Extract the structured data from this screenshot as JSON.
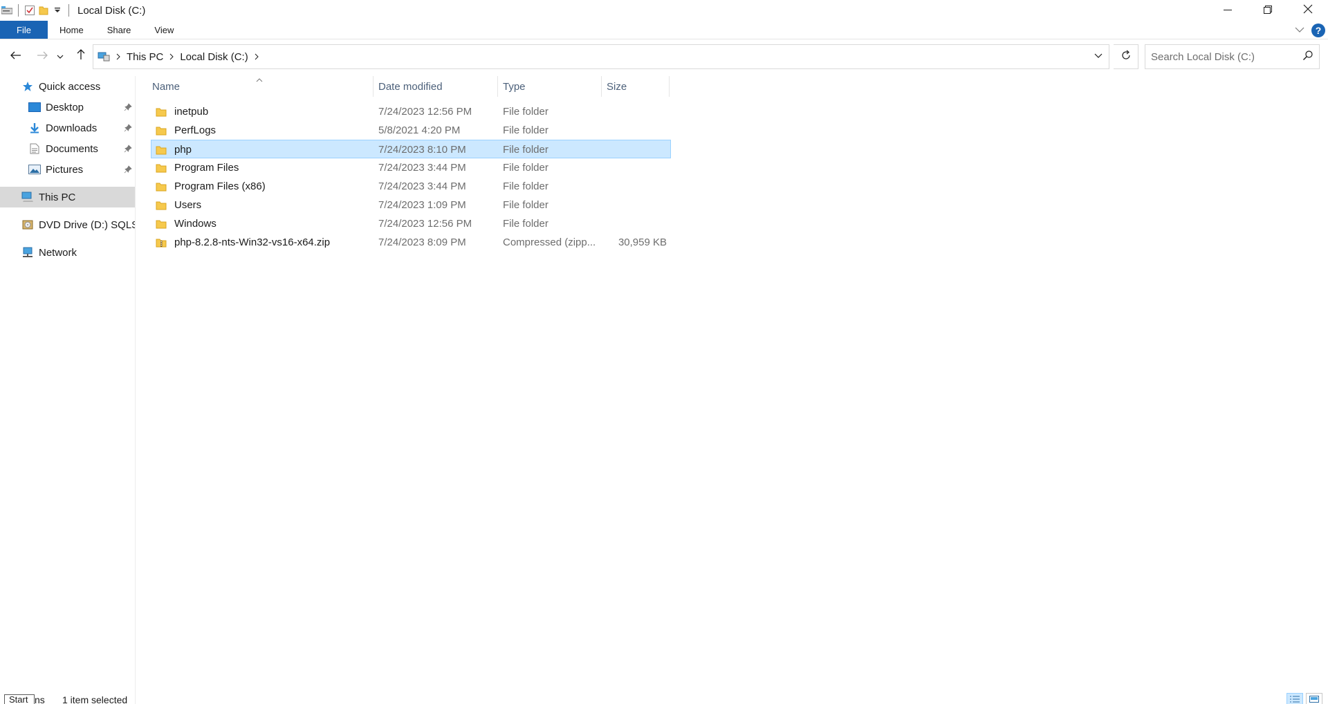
{
  "window": {
    "title": "Local Disk (C:)",
    "icons": [
      "explorer-app-icon",
      "properties-icon",
      "new-folder-icon",
      "customize-qat-icon"
    ],
    "controls": [
      "minimize-icon",
      "restore-icon",
      "close-icon"
    ]
  },
  "ribbon": {
    "tabs": [
      {
        "label": "File",
        "active": true
      },
      {
        "label": "Home"
      },
      {
        "label": "Share"
      },
      {
        "label": "View"
      }
    ],
    "help": "?"
  },
  "navigation": {
    "breadcrumb": [
      "This PC",
      "Local Disk (C:)"
    ],
    "search_placeholder": "Search Local Disk (C:)"
  },
  "sidebar": {
    "items": [
      {
        "label": "Quick access",
        "icon": "star-icon"
      },
      {
        "label": "Desktop",
        "icon": "desktop-icon",
        "pinned": true
      },
      {
        "label": "Downloads",
        "icon": "download-icon",
        "pinned": true
      },
      {
        "label": "Documents",
        "icon": "documents-icon",
        "pinned": true
      },
      {
        "label": "Pictures",
        "icon": "pictures-icon",
        "pinned": true
      },
      {
        "label": "This PC",
        "icon": "computer-icon",
        "selected": true
      },
      {
        "label": "DVD Drive (D:) SQLSe",
        "icon": "dvd-drive-icon"
      },
      {
        "label": "Network",
        "icon": "network-icon"
      }
    ]
  },
  "columns": {
    "name": "Name",
    "date": "Date modified",
    "type": "Type",
    "size": "Size"
  },
  "files": [
    {
      "name": "inetpub",
      "date": "7/24/2023 12:56 PM",
      "type": "File folder",
      "size": "",
      "icon": "folder-icon"
    },
    {
      "name": "PerfLogs",
      "date": "5/8/2021 4:20 PM",
      "type": "File folder",
      "size": "",
      "icon": "folder-icon"
    },
    {
      "name": "php",
      "date": "7/24/2023 8:10 PM",
      "type": "File folder",
      "size": "",
      "icon": "folder-icon",
      "selected": true
    },
    {
      "name": "Program Files",
      "date": "7/24/2023 3:44 PM",
      "type": "File folder",
      "size": "",
      "icon": "folder-icon"
    },
    {
      "name": "Program Files (x86)",
      "date": "7/24/2023 3:44 PM",
      "type": "File folder",
      "size": "",
      "icon": "folder-icon"
    },
    {
      "name": "Users",
      "date": "7/24/2023 1:09 PM",
      "type": "File folder",
      "size": "",
      "icon": "folder-icon"
    },
    {
      "name": "Windows",
      "date": "7/24/2023 12:56 PM",
      "type": "File folder",
      "size": "",
      "icon": "folder-icon"
    },
    {
      "name": "php-8.2.8-nts-Win32-vs16-x64.zip",
      "date": "7/24/2023 8:09 PM",
      "type": "Compressed (zipp...",
      "size": "30,959 KB",
      "icon": "zip-folder-icon"
    }
  ],
  "status": {
    "start_label": "Start",
    "count_fragment": "ns",
    "selection": "1 item selected"
  },
  "colors": {
    "accent": "#1a64b4",
    "selection_bg": "#cce8ff",
    "selection_border": "#99d1ff",
    "folder": "#f6c94d"
  }
}
